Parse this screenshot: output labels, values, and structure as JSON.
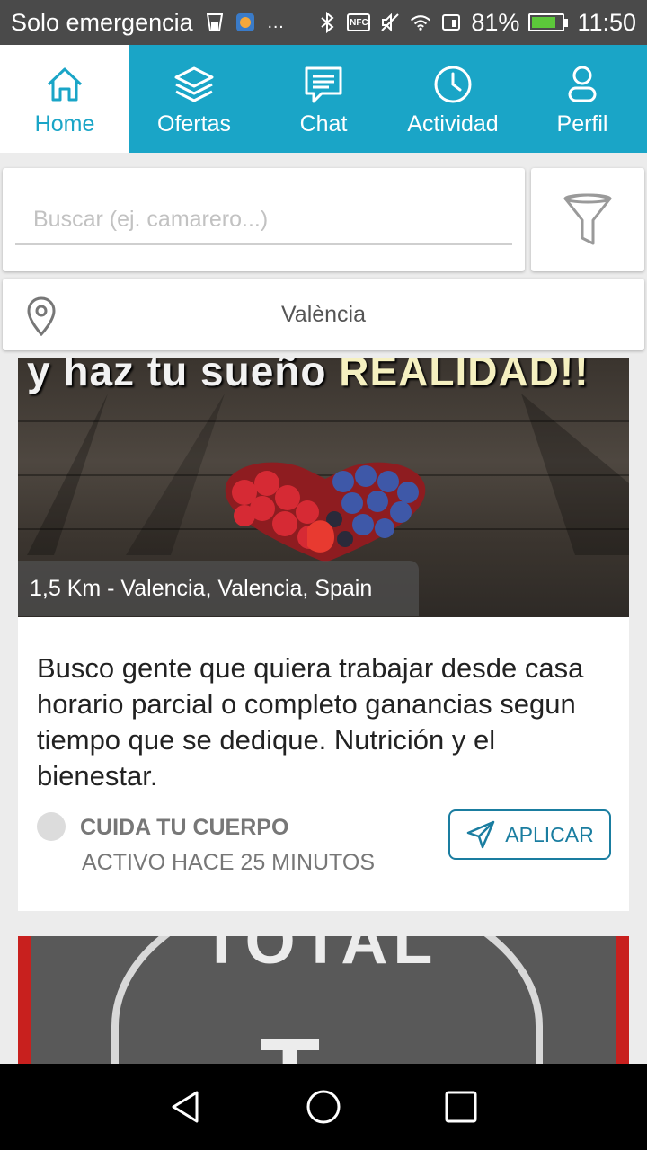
{
  "status_bar": {
    "carrier": "Solo emergencia",
    "nfc_label": "NFC",
    "battery_percent": "81%",
    "battery_level": 0.81,
    "time": "11:50"
  },
  "nav": {
    "items": [
      {
        "label": "Home",
        "icon": "home-icon"
      },
      {
        "label": "Ofertas",
        "icon": "layers-icon"
      },
      {
        "label": "Chat",
        "icon": "chat-icon"
      },
      {
        "label": "Actividad",
        "icon": "clock-icon"
      },
      {
        "label": "Perfil",
        "icon": "person-icon"
      }
    ],
    "active_index": 0
  },
  "search": {
    "placeholder": "Buscar (ej. camarero...)",
    "value": ""
  },
  "location": {
    "label": "València"
  },
  "jobs": [
    {
      "image_text_pre": "y haz tu sueño ",
      "image_text_highlight": "REALIDAD!!",
      "distance": "1,5 Km - Valencia, Valencia, Spain",
      "description": "Busco gente que quiera trabajar desde casa horario parcial o completo ganancias segun tiempo que se dedique. Nutrición y el bienestar.",
      "company": "CUIDA TU CUERPO",
      "activity": "ACTIVO HACE 25 MINUTOS",
      "apply_label": "APLICAR"
    },
    {
      "image_text": "TOTAL",
      "image_letter": "T"
    }
  ],
  "colors": {
    "primary": "#1aa5c7",
    "apply": "#1a7da0",
    "status_bar": "#4a4a4a",
    "battery_fill": "#5cc83a"
  }
}
